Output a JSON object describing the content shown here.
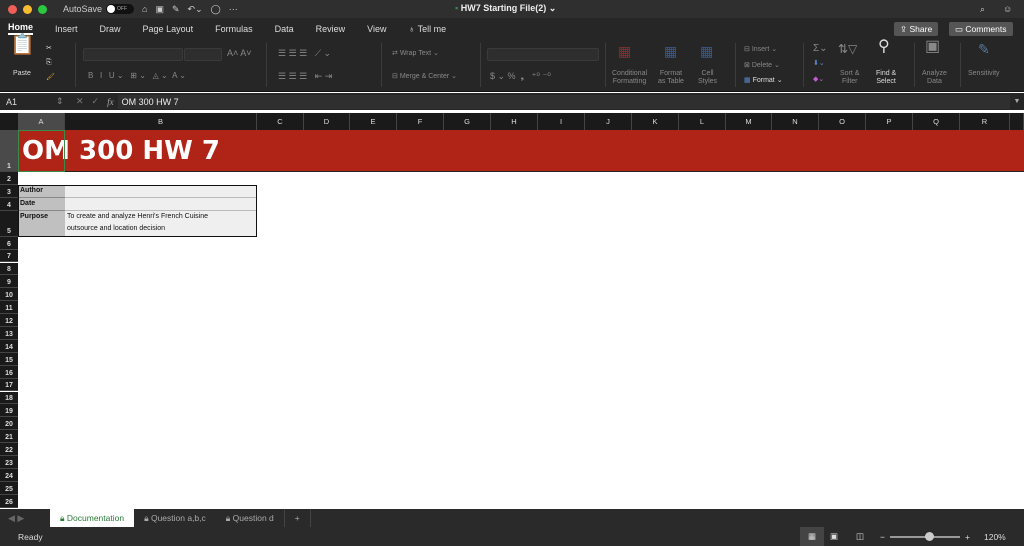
{
  "titlebar": {
    "autosave": "AutoSave",
    "toggle": "OFF",
    "file": "HW7 Starting File(2)"
  },
  "tabs": [
    "Home",
    "Insert",
    "Draw",
    "Page Layout",
    "Formulas",
    "Data",
    "Review",
    "View"
  ],
  "tell_me": "Tell me",
  "share": "Share",
  "comments": "Comments",
  "ribbon": {
    "paste": "Paste",
    "wrap": "Wrap Text",
    "merge": "Merge & Center",
    "cond": [
      "Conditional",
      "Formatting"
    ],
    "fmt_table": [
      "Format",
      "as Table"
    ],
    "cell_styles": [
      "Cell",
      "Styles"
    ],
    "insert": "Insert",
    "delete": "Delete",
    "format": "Format",
    "sort": [
      "Sort &",
      "Filter"
    ],
    "find": [
      "Find &",
      "Select"
    ],
    "analyze": [
      "Analyze",
      "Data"
    ],
    "sensitivity": "Sensitivity"
  },
  "formula": {
    "name_box": "A1",
    "fx": "fx",
    "content": "OM 300 HW 7"
  },
  "columns": [
    "A",
    "B",
    "C",
    "D",
    "E",
    "F",
    "G",
    "H",
    "I",
    "J",
    "K",
    "L",
    "M",
    "N",
    "O",
    "P",
    "Q",
    "R"
  ],
  "rows": [
    "1",
    "2",
    "3",
    "4",
    "5",
    "6",
    "7",
    "8",
    "9",
    "10",
    "11",
    "12",
    "13",
    "14",
    "15",
    "16",
    "17",
    "18",
    "19",
    "20",
    "21",
    "22",
    "23",
    "24",
    "25",
    "26"
  ],
  "cells": {
    "title": "OM 300 HW 7",
    "author": "Author",
    "date": "Date",
    "purpose": "Purpose",
    "purpose_text1": "To create and analyze Henri's French Cuisine",
    "purpose_text2": "outsource and location decision"
  },
  "sheets": [
    {
      "name": "Documentation",
      "active": true
    },
    {
      "name": "Question a,b,c"
    },
    {
      "name": "Question d"
    }
  ],
  "add_sheet": "+",
  "status": {
    "ready": "Ready",
    "zoom": "120%"
  },
  "colors": {
    "title_fill": "#b02418",
    "label_fill": "#c0c0c0",
    "value_fill": "#efefef"
  }
}
